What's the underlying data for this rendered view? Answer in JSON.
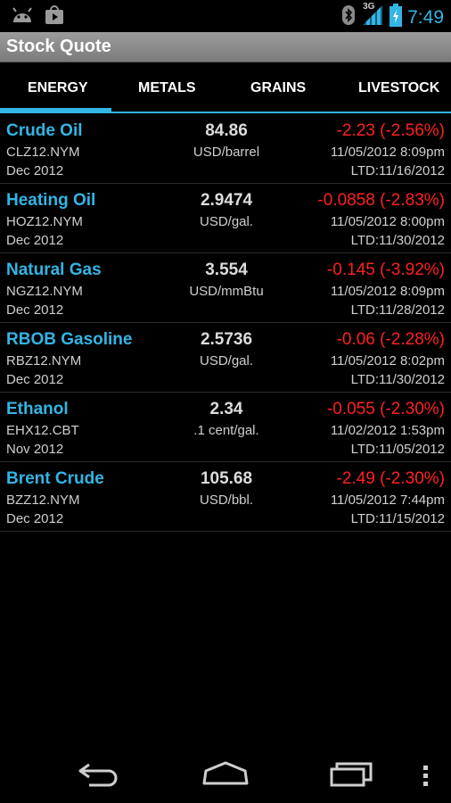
{
  "status": {
    "network": "3G",
    "time": "7:49"
  },
  "app": {
    "title": "Stock Quote"
  },
  "tabs": [
    {
      "label": "ENERGY",
      "active": true
    },
    {
      "label": "METALS",
      "active": false
    },
    {
      "label": "GRAINS",
      "active": false
    },
    {
      "label": "LIVESTOCK",
      "active": false
    }
  ],
  "quotes": [
    {
      "name": "Crude Oil",
      "symbol": "CLZ12.NYM",
      "month": "Dec 2012",
      "price": "84.86",
      "unit": "USD/barrel",
      "change": "-2.23 (-2.56%)",
      "time": "11/05/2012 8:09pm",
      "ltd": "LTD:11/16/2012"
    },
    {
      "name": "Heating Oil",
      "symbol": "HOZ12.NYM",
      "month": "Dec 2012",
      "price": "2.9474",
      "unit": "USD/gal.",
      "change": "-0.0858 (-2.83%)",
      "time": "11/05/2012 8:00pm",
      "ltd": "LTD:11/30/2012"
    },
    {
      "name": "Natural Gas",
      "symbol": "NGZ12.NYM",
      "month": "Dec 2012",
      "price": "3.554",
      "unit": "USD/mmBtu",
      "change": "-0.145 (-3.92%)",
      "time": "11/05/2012 8:09pm",
      "ltd": "LTD:11/28/2012"
    },
    {
      "name": "RBOB Gasoline",
      "symbol": "RBZ12.NYM",
      "month": "Dec 2012",
      "price": "2.5736",
      "unit": "USD/gal.",
      "change": "-0.06 (-2.28%)",
      "time": "11/05/2012 8:02pm",
      "ltd": "LTD:11/30/2012"
    },
    {
      "name": "Ethanol",
      "symbol": "EHX12.CBT",
      "month": "Nov 2012",
      "price": "2.34",
      "unit": ".1 cent/gal.",
      "change": "-0.055 (-2.30%)",
      "time": "11/02/2012 1:53pm",
      "ltd": "LTD:11/05/2012"
    },
    {
      "name": "Brent Crude",
      "symbol": "BZZ12.NYM",
      "month": "Dec 2012",
      "price": "105.68",
      "unit": "USD/bbl.",
      "change": "-2.49 (-2.30%)",
      "time": "11/05/2012 7:44pm",
      "ltd": "LTD:11/15/2012"
    }
  ],
  "colors": {
    "accent": "#33b5e5",
    "negative": "#ff2020"
  }
}
